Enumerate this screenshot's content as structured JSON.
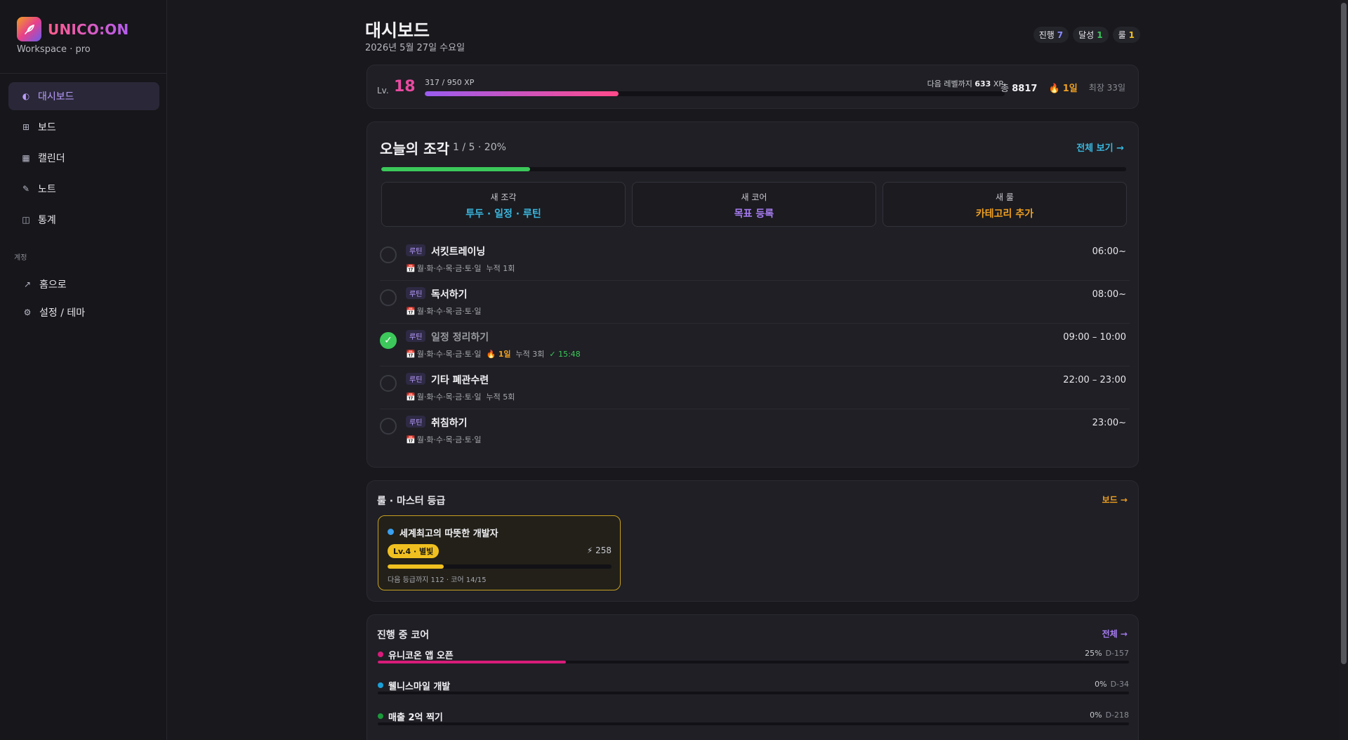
{
  "brand": {
    "name": "UNICO:ON",
    "logo": "feather-icon",
    "subtitle": "Workspace · pro"
  },
  "nav": [
    {
      "label": "대시보드",
      "icon": "◐",
      "active": true
    },
    {
      "label": "보드",
      "icon": "⊞",
      "active": false
    },
    {
      "label": "캘린더",
      "icon": "▦",
      "active": false
    },
    {
      "label": "노트",
      "icon": "✎",
      "active": false
    },
    {
      "label": "통계",
      "icon": "◫",
      "active": false
    }
  ],
  "account": {
    "label": "계정",
    "items": [
      {
        "label": "홈으로",
        "icon": "↗"
      },
      {
        "label": "설정 / 테마",
        "icon": "⚙"
      }
    ]
  },
  "header": {
    "title": "대시보드",
    "date": "2026년 5월 27일 수요일",
    "pills": [
      {
        "label": "진행",
        "value": "7",
        "color": "#8a8cff"
      },
      {
        "label": "달성",
        "value": "1",
        "color": "#3cc85a"
      },
      {
        "label": "룰",
        "value": "1",
        "color": "#f0c020"
      }
    ]
  },
  "level": {
    "label": "Lv.",
    "value": "18",
    "xp_text": "317 / 950 XP",
    "xp_fraction": 0.334,
    "next_prefix": "다음 레벨까지",
    "next_value": "633",
    "next_suffix": "XP",
    "total_prefix": "총",
    "total_value": "8817",
    "streak_icon": "🔥",
    "streak": "1일",
    "best": "최장 33일"
  },
  "today": {
    "title": "오늘의 조각",
    "count": "1 / 5 · 20%",
    "progress": 0.2,
    "view_all": "전체 보기 →",
    "add_boxes": [
      {
        "label": "새 조각",
        "action": "투두 · 일정 · 루틴",
        "color": "#3ab8e0"
      },
      {
        "label": "새 코어",
        "action": "목표 등록",
        "color": "#a67cf0"
      },
      {
        "label": "새 룰",
        "action": "카테고리 추가",
        "color": "#f0a020"
      }
    ],
    "tasks": [
      {
        "tag": "루틴",
        "name": "서킷트레이닝",
        "days": "월·화·수·목·금·토·일",
        "streak": "",
        "count": "누적 1회",
        "done_time": "",
        "time": "06:00~",
        "done": false
      },
      {
        "tag": "루틴",
        "name": "독서하기",
        "days": "월·화·수·목·금·토·일",
        "streak": "",
        "count": "",
        "done_time": "",
        "time": "08:00~",
        "done": false
      },
      {
        "tag": "루틴",
        "name": "일정 정리하기",
        "days": "월·화·수·목·금·토·일",
        "streak": "1일",
        "count": "누적 3회",
        "done_time": "✓ 15:48",
        "time": "09:00 – 10:00",
        "done": true
      },
      {
        "tag": "루틴",
        "name": "기타 폐관수련",
        "days": "월·화·수·목·금·토·일",
        "streak": "",
        "count": "누적 5회",
        "done_time": "",
        "time": "22:00 – 23:00",
        "done": false
      },
      {
        "tag": "루틴",
        "name": "취침하기",
        "days": "월·화·수·목·금·토·일",
        "streak": "",
        "count": "",
        "done_time": "",
        "time": "23:00~",
        "done": false
      }
    ]
  },
  "master": {
    "title": "룰 · 마스터 등급",
    "link": "보드 →",
    "name": "세계최고의 따뜻한 개발자",
    "badge": "Lv.4 · 별빛",
    "score": "⚡ 258",
    "progress": 0.25,
    "next_text": "다음 등급까지 112 · 코어 14/15",
    "dot_color": "#3aa0f0"
  },
  "cores": {
    "title": "진행 중 코어",
    "link": "전체 →",
    "items": [
      {
        "name": "유니코온 앱 오픈",
        "percent": "25%",
        "dday": "D-157",
        "progress": 0.25,
        "color": "#d81b7a"
      },
      {
        "name": "웰니스마일 개발",
        "percent": "0%",
        "dday": "D-34",
        "progress": 0,
        "color": "#1aa0d8"
      },
      {
        "name": "매출 2억 찍기",
        "percent": "0%",
        "dday": "D-218",
        "progress": 0,
        "color": "#1a9a3a"
      }
    ]
  }
}
